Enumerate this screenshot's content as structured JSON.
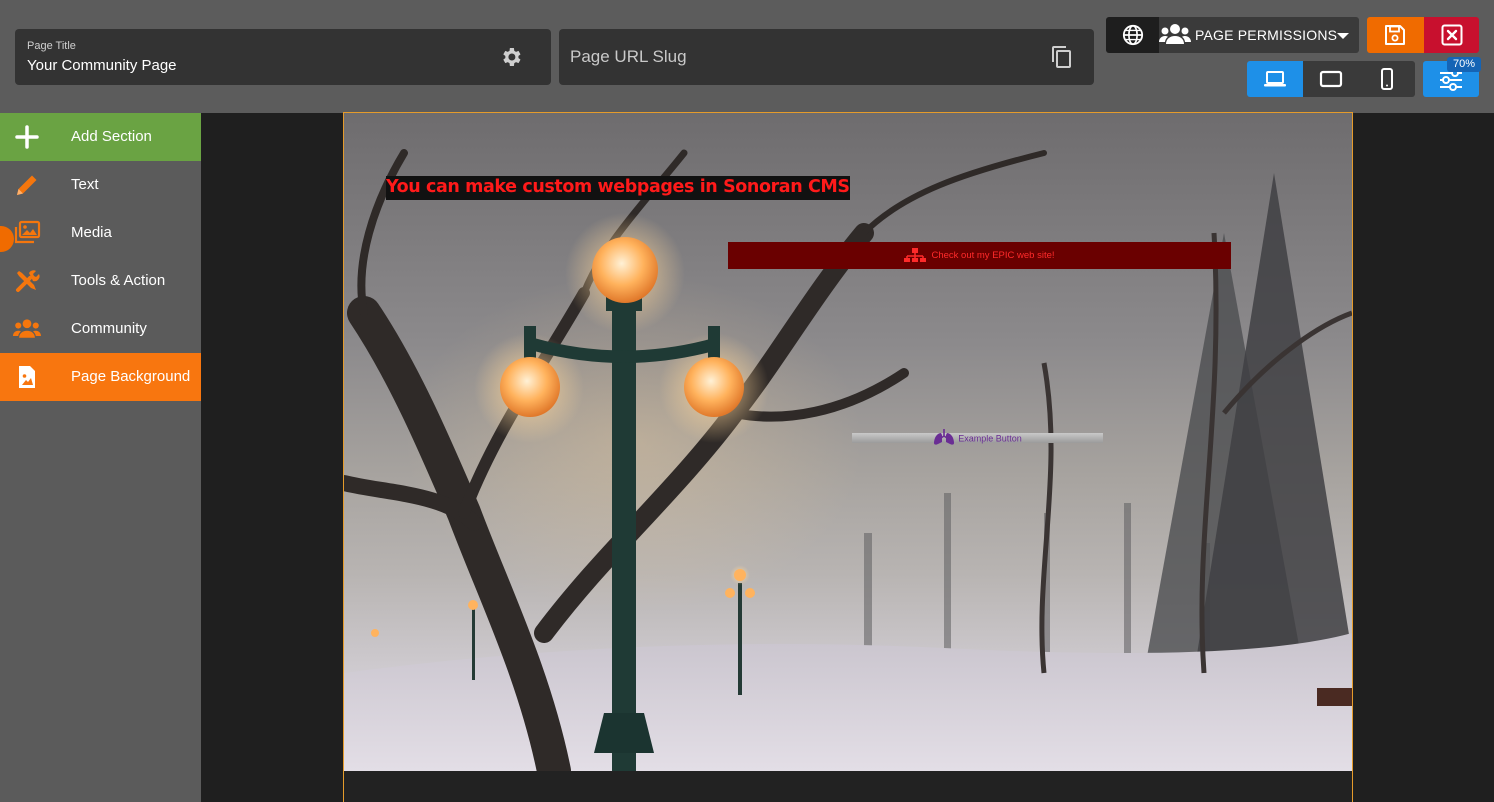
{
  "header": {
    "page_title_label": "Page Title",
    "page_title_value": "Your Community Page",
    "slug_placeholder": "Page URL Slug",
    "permissions_label": "PAGE PERMISSIONS",
    "zoom_badge": "70%"
  },
  "sidebar": {
    "items": [
      {
        "label": "Add Section",
        "icon": "plus-icon"
      },
      {
        "label": "Text",
        "icon": "pencil-icon"
      },
      {
        "label": "Media",
        "icon": "images-icon"
      },
      {
        "label": "Tools & Action",
        "icon": "tools-icon"
      },
      {
        "label": "Community",
        "icon": "users-icon"
      },
      {
        "label": "Page Background",
        "icon": "image-file-icon"
      }
    ],
    "active_item": "Page Background"
  },
  "canvas": {
    "headline": "You can make custom webpages in Sonoran CMS",
    "epic_button": "Check out my EPIC web site!",
    "example_button": "Example Button"
  },
  "colors": {
    "accent_orange": "#f06b00",
    "add_green": "#6aa343",
    "close_red": "#c8102e",
    "view_blue": "#1e90e8",
    "headline_red": "#ff1a1a"
  }
}
